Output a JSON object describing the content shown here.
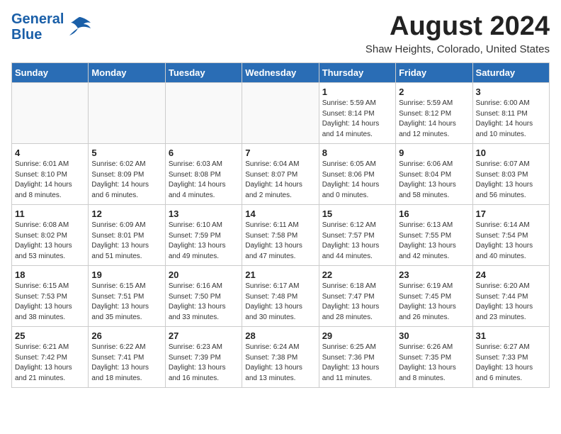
{
  "header": {
    "logo_line1": "General",
    "logo_line2": "Blue",
    "month": "August 2024",
    "location": "Shaw Heights, Colorado, United States"
  },
  "days_of_week": [
    "Sunday",
    "Monday",
    "Tuesday",
    "Wednesday",
    "Thursday",
    "Friday",
    "Saturday"
  ],
  "weeks": [
    [
      {
        "day": "",
        "info": ""
      },
      {
        "day": "",
        "info": ""
      },
      {
        "day": "",
        "info": ""
      },
      {
        "day": "",
        "info": ""
      },
      {
        "day": "1",
        "info": "Sunrise: 5:59 AM\nSunset: 8:14 PM\nDaylight: 14 hours\nand 14 minutes."
      },
      {
        "day": "2",
        "info": "Sunrise: 5:59 AM\nSunset: 8:12 PM\nDaylight: 14 hours\nand 12 minutes."
      },
      {
        "day": "3",
        "info": "Sunrise: 6:00 AM\nSunset: 8:11 PM\nDaylight: 14 hours\nand 10 minutes."
      }
    ],
    [
      {
        "day": "4",
        "info": "Sunrise: 6:01 AM\nSunset: 8:10 PM\nDaylight: 14 hours\nand 8 minutes."
      },
      {
        "day": "5",
        "info": "Sunrise: 6:02 AM\nSunset: 8:09 PM\nDaylight: 14 hours\nand 6 minutes."
      },
      {
        "day": "6",
        "info": "Sunrise: 6:03 AM\nSunset: 8:08 PM\nDaylight: 14 hours\nand 4 minutes."
      },
      {
        "day": "7",
        "info": "Sunrise: 6:04 AM\nSunset: 8:07 PM\nDaylight: 14 hours\nand 2 minutes."
      },
      {
        "day": "8",
        "info": "Sunrise: 6:05 AM\nSunset: 8:06 PM\nDaylight: 14 hours\nand 0 minutes."
      },
      {
        "day": "9",
        "info": "Sunrise: 6:06 AM\nSunset: 8:04 PM\nDaylight: 13 hours\nand 58 minutes."
      },
      {
        "day": "10",
        "info": "Sunrise: 6:07 AM\nSunset: 8:03 PM\nDaylight: 13 hours\nand 56 minutes."
      }
    ],
    [
      {
        "day": "11",
        "info": "Sunrise: 6:08 AM\nSunset: 8:02 PM\nDaylight: 13 hours\nand 53 minutes."
      },
      {
        "day": "12",
        "info": "Sunrise: 6:09 AM\nSunset: 8:01 PM\nDaylight: 13 hours\nand 51 minutes."
      },
      {
        "day": "13",
        "info": "Sunrise: 6:10 AM\nSunset: 7:59 PM\nDaylight: 13 hours\nand 49 minutes."
      },
      {
        "day": "14",
        "info": "Sunrise: 6:11 AM\nSunset: 7:58 PM\nDaylight: 13 hours\nand 47 minutes."
      },
      {
        "day": "15",
        "info": "Sunrise: 6:12 AM\nSunset: 7:57 PM\nDaylight: 13 hours\nand 44 minutes."
      },
      {
        "day": "16",
        "info": "Sunrise: 6:13 AM\nSunset: 7:55 PM\nDaylight: 13 hours\nand 42 minutes."
      },
      {
        "day": "17",
        "info": "Sunrise: 6:14 AM\nSunset: 7:54 PM\nDaylight: 13 hours\nand 40 minutes."
      }
    ],
    [
      {
        "day": "18",
        "info": "Sunrise: 6:15 AM\nSunset: 7:53 PM\nDaylight: 13 hours\nand 38 minutes."
      },
      {
        "day": "19",
        "info": "Sunrise: 6:15 AM\nSunset: 7:51 PM\nDaylight: 13 hours\nand 35 minutes."
      },
      {
        "day": "20",
        "info": "Sunrise: 6:16 AM\nSunset: 7:50 PM\nDaylight: 13 hours\nand 33 minutes."
      },
      {
        "day": "21",
        "info": "Sunrise: 6:17 AM\nSunset: 7:48 PM\nDaylight: 13 hours\nand 30 minutes."
      },
      {
        "day": "22",
        "info": "Sunrise: 6:18 AM\nSunset: 7:47 PM\nDaylight: 13 hours\nand 28 minutes."
      },
      {
        "day": "23",
        "info": "Sunrise: 6:19 AM\nSunset: 7:45 PM\nDaylight: 13 hours\nand 26 minutes."
      },
      {
        "day": "24",
        "info": "Sunrise: 6:20 AM\nSunset: 7:44 PM\nDaylight: 13 hours\nand 23 minutes."
      }
    ],
    [
      {
        "day": "25",
        "info": "Sunrise: 6:21 AM\nSunset: 7:42 PM\nDaylight: 13 hours\nand 21 minutes."
      },
      {
        "day": "26",
        "info": "Sunrise: 6:22 AM\nSunset: 7:41 PM\nDaylight: 13 hours\nand 18 minutes."
      },
      {
        "day": "27",
        "info": "Sunrise: 6:23 AM\nSunset: 7:39 PM\nDaylight: 13 hours\nand 16 minutes."
      },
      {
        "day": "28",
        "info": "Sunrise: 6:24 AM\nSunset: 7:38 PM\nDaylight: 13 hours\nand 13 minutes."
      },
      {
        "day": "29",
        "info": "Sunrise: 6:25 AM\nSunset: 7:36 PM\nDaylight: 13 hours\nand 11 minutes."
      },
      {
        "day": "30",
        "info": "Sunrise: 6:26 AM\nSunset: 7:35 PM\nDaylight: 13 hours\nand 8 minutes."
      },
      {
        "day": "31",
        "info": "Sunrise: 6:27 AM\nSunset: 7:33 PM\nDaylight: 13 hours\nand 6 minutes."
      }
    ]
  ]
}
